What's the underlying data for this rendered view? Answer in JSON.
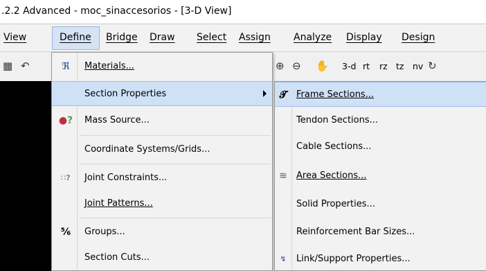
{
  "window": {
    "title": ".2.2 Advanced  - moc_sinaccesorios - [3-D View]"
  },
  "menubar": {
    "items": [
      {
        "label": "View"
      },
      {
        "label": "Define"
      },
      {
        "label": "Bridge"
      },
      {
        "label": "Draw"
      },
      {
        "label": "Select"
      },
      {
        "label": "Assign"
      },
      {
        "label": "Analyze"
      },
      {
        "label": "Display"
      },
      {
        "label": "Design"
      }
    ]
  },
  "toolbar": {
    "view_labels": [
      "3-d",
      "rt",
      "rz",
      "tz",
      "nv"
    ]
  },
  "define_menu": {
    "items": [
      {
        "label": "Materials...",
        "icon": "materials-icon"
      },
      {
        "label": "Section Properties",
        "has_submenu": true,
        "highlighted": true
      },
      {
        "label": "Mass Source...",
        "icon": "mass-source-icon"
      },
      {
        "label": "Coordinate Systems/Grids..."
      },
      {
        "label": "Joint Constraints...",
        "icon": "joint-constraints-icon"
      },
      {
        "label": "Joint Patterns..."
      },
      {
        "label": "Groups...",
        "icon": "groups-icon"
      },
      {
        "label": "Section Cuts..."
      }
    ]
  },
  "section_properties_menu": {
    "items": [
      {
        "label": "Frame Sections...",
        "icon": "frame-sections-icon",
        "highlighted": true
      },
      {
        "label": "Tendon Sections..."
      },
      {
        "label": "Cable Sections..."
      },
      {
        "label": "Area Sections...",
        "icon": "area-sections-icon"
      },
      {
        "label": "Solid Properties..."
      },
      {
        "label": "Reinforcement Bar Sizes..."
      },
      {
        "label": "Link/Support Properties...",
        "icon": "link-support-icon"
      }
    ]
  },
  "colors": {
    "highlight": "#cfe1f7",
    "highlight_border": "#9cbde8",
    "menu_bg": "#f2f2f2",
    "canvas_bg": "#000000"
  }
}
